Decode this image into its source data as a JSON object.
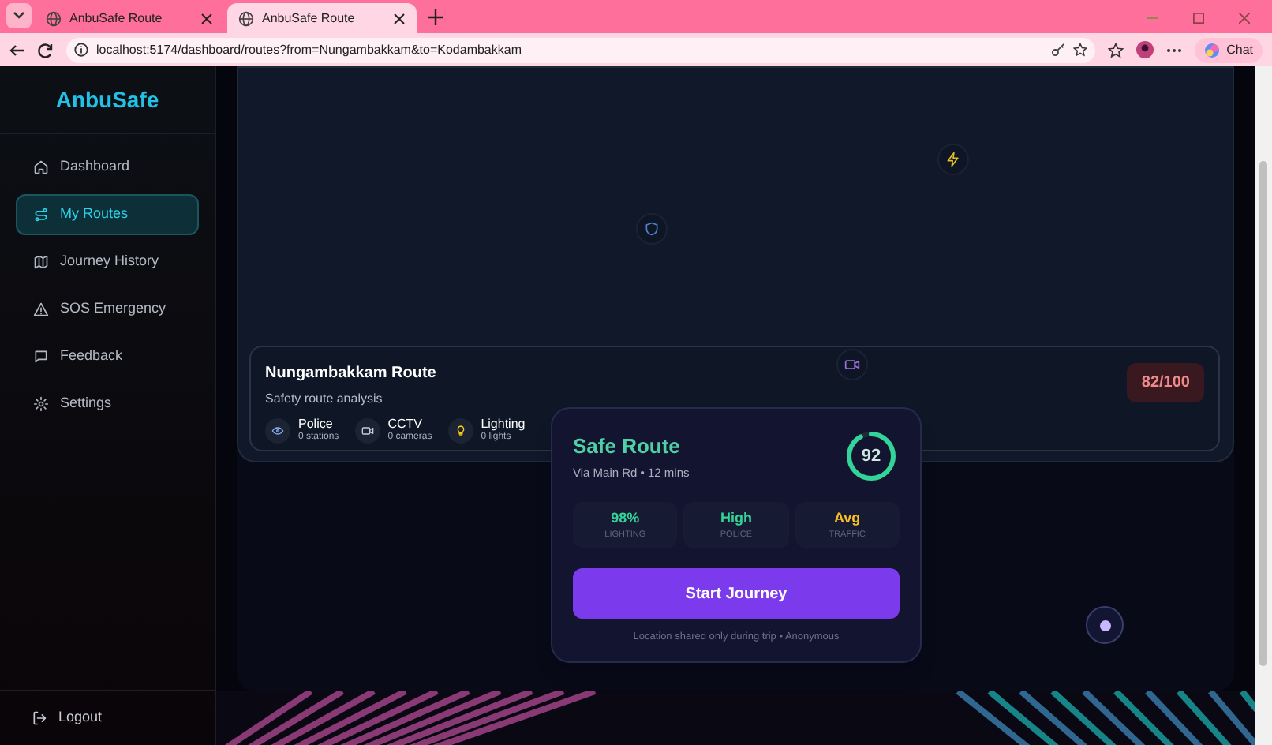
{
  "browser": {
    "tabs": [
      {
        "title": "AnbuSafe Route",
        "selected": false
      },
      {
        "title": "AnbuSafe Route",
        "selected": true
      }
    ],
    "url": "localhost:5174/dashboard/routes?from=Nungambakkam&to=Kodambakkam",
    "chat": "Chat"
  },
  "sidebar": {
    "logo": "AnbuSafe",
    "items": [
      {
        "label": "Dashboard",
        "kind": "home",
        "selected": false
      },
      {
        "label": "My Routes",
        "kind": "routes",
        "selected": true
      },
      {
        "label": "Journey History",
        "kind": "map",
        "selected": false
      },
      {
        "label": "SOS Emergency",
        "kind": "alert",
        "selected": false
      },
      {
        "label": "Feedback",
        "kind": "chat",
        "selected": false
      },
      {
        "label": "Settings",
        "kind": "gear",
        "selected": false
      }
    ],
    "logout": "Logout"
  },
  "route_card": {
    "title": "Nungambakkam Route",
    "subtitle": "Safety route analysis",
    "score": "82/100",
    "stats": [
      {
        "kind": "police",
        "label": "Police",
        "value": "0 stations"
      },
      {
        "kind": "cctv",
        "label": "CCTV",
        "value": "0 cameras"
      },
      {
        "kind": "lighting",
        "label": "Lighting",
        "value": "0 lights"
      }
    ]
  },
  "popup": {
    "title": "Safe Route",
    "subtitle": "Via Main Rd • 12 mins",
    "score": "92",
    "metrics": [
      {
        "value": "98%",
        "label": "LIGHTING",
        "color": "#34d399"
      },
      {
        "value": "High",
        "label": "POLICE",
        "color": "#34d399"
      },
      {
        "value": "Avg",
        "label": "TRAFFIC",
        "color": "#fbbf24"
      }
    ],
    "button": "Start Journey",
    "note": "Location shared only during trip • Anonymous"
  }
}
